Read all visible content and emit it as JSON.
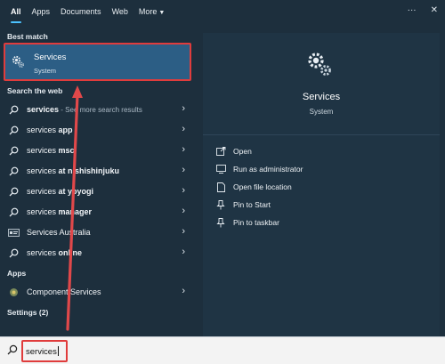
{
  "tabs": [
    {
      "label": "All",
      "active": true
    },
    {
      "label": "Apps"
    },
    {
      "label": "Documents"
    },
    {
      "label": "Web"
    },
    {
      "label": "More"
    }
  ],
  "tabs_right": {
    "more_dots": "···",
    "close": "✕"
  },
  "sections": {
    "best_match": "Best match",
    "search_web": "Search the web",
    "apps": "Apps",
    "settings": "Settings (2)"
  },
  "best_match": {
    "title": "Services",
    "subtitle": "System"
  },
  "web_results": [
    {
      "bold": "services",
      "rest": " - See more search results",
      "rest_dim": true
    },
    {
      "bold": "services ",
      "rest": "app"
    },
    {
      "bold": "services ",
      "rest": "msc"
    },
    {
      "bold": "services ",
      "rest": "at nishishinjuku"
    },
    {
      "bold": "services ",
      "rest": "at yoyogi"
    },
    {
      "bold": "services ",
      "rest": "manager"
    },
    {
      "bold": "Services Australia",
      "rest": "",
      "plain": true
    },
    {
      "bold": "services ",
      "rest": "online"
    }
  ],
  "apps": [
    {
      "label": "Component Services"
    }
  ],
  "detail": {
    "title": "Services",
    "subtitle": "System",
    "actions": [
      {
        "label": "Open",
        "icon": "open-icon"
      },
      {
        "label": "Run as administrator",
        "icon": "shield-icon"
      },
      {
        "label": "Open file location",
        "icon": "file-icon"
      },
      {
        "label": "Pin to Start",
        "icon": "pin-icon"
      },
      {
        "label": "Pin to taskbar",
        "icon": "pin-icon"
      }
    ]
  },
  "search": {
    "value": "services"
  },
  "colors": {
    "panel": "#1d2f3d",
    "highlight": "#2c5e85",
    "annotation_red": "#e03c3c"
  }
}
